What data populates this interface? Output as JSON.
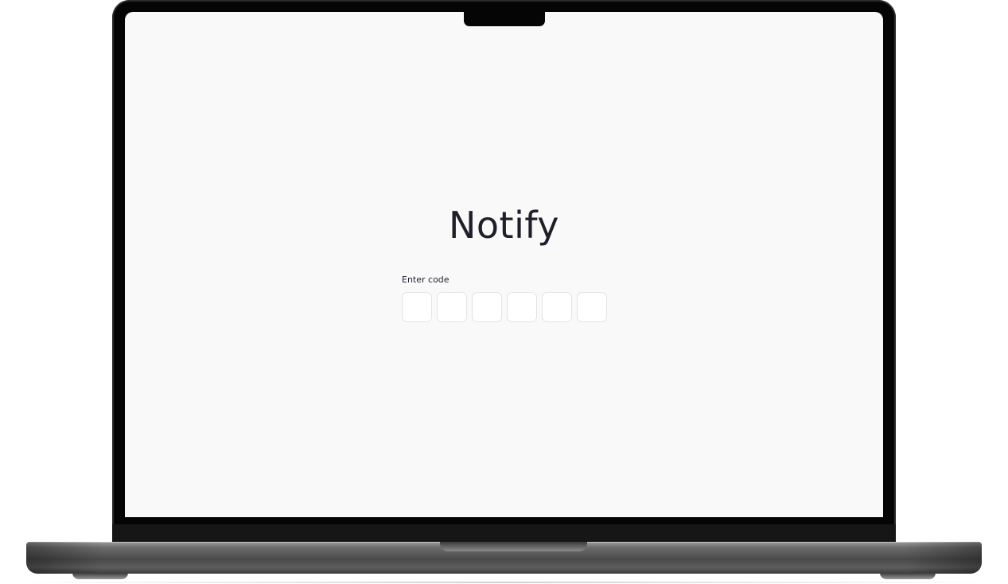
{
  "app": {
    "name": "Notify"
  },
  "verification": {
    "label": "Enter code",
    "digits": [
      "",
      "",
      "",
      "",
      "",
      ""
    ]
  },
  "colors": {
    "screen_background": "#f9f9f9",
    "text": "#1e1f2a",
    "input_border": "#e3e3e6",
    "bezel": "#050505"
  }
}
